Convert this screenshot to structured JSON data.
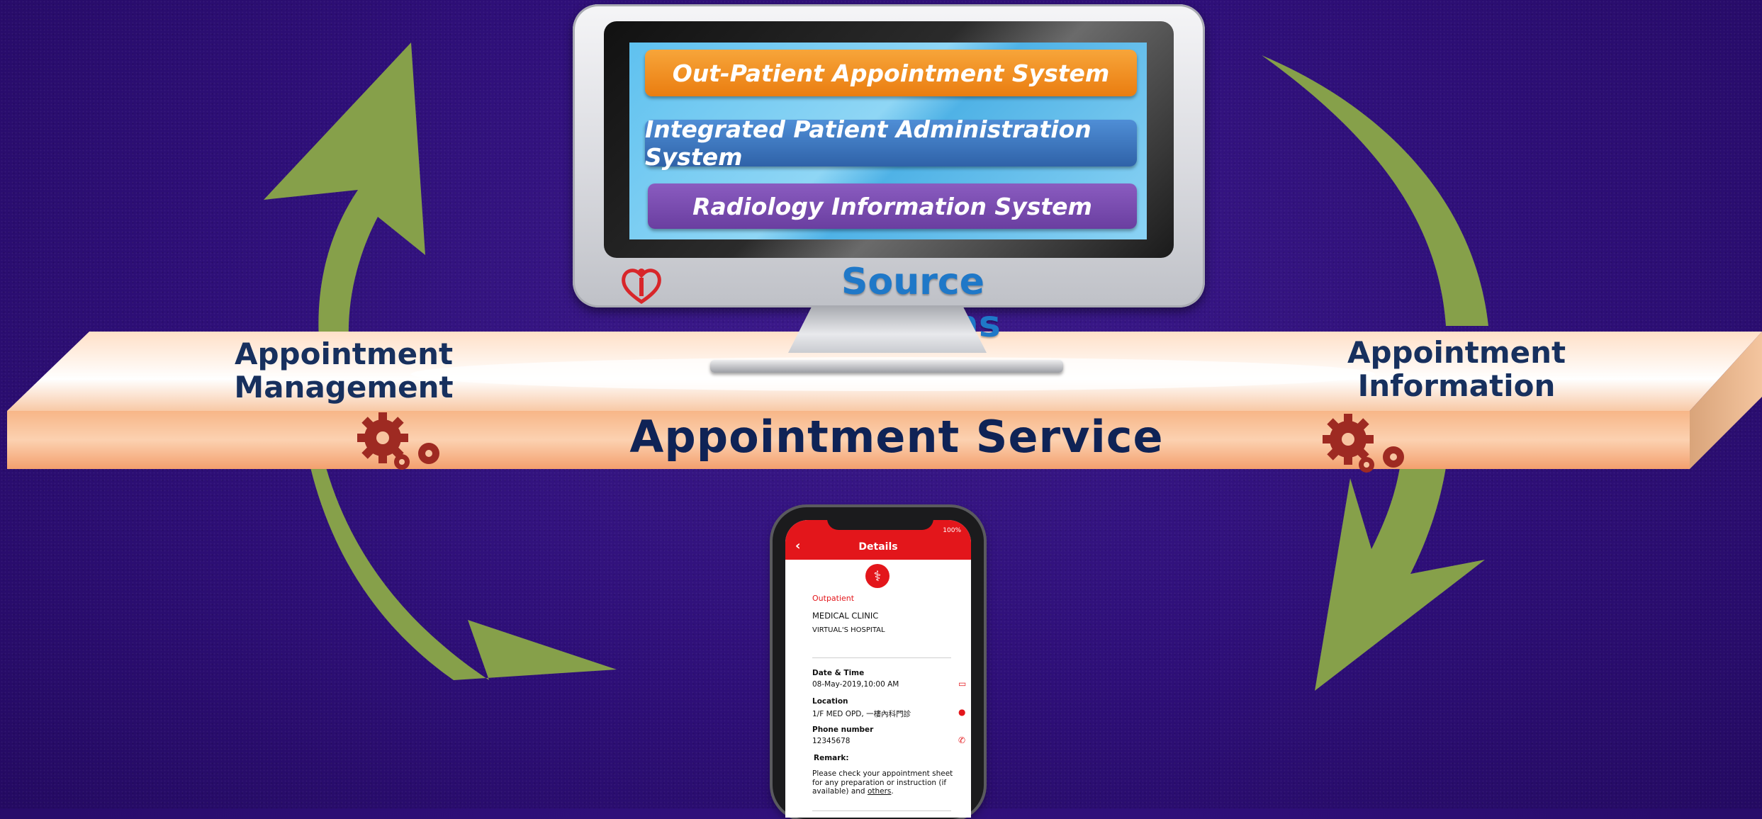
{
  "monitor": {
    "systems": [
      {
        "label": "Out-Patient Appointment System",
        "color": "#ea7d10"
      },
      {
        "label": "Integrated Patient Administration System",
        "color": "#2f62a8"
      },
      {
        "label": "Radiology Information System",
        "color": "#6a3ea0"
      }
    ],
    "title": "Source Systems",
    "logo_icon": "hospital-authority-logo"
  },
  "band": {
    "left_label_line1": "Appointment",
    "left_label_line2": "Management",
    "right_label_line1": "Appointment",
    "right_label_line2": "Information",
    "title": "Appointment Service",
    "gear_icon": "gears-icon"
  },
  "arrows": {
    "color": "#86a04a",
    "icon": "cycle-arrow-icon"
  },
  "phone": {
    "status": "100%",
    "back_icon": "chevron-left-icon",
    "title": "Details",
    "category": "Outpatient",
    "clinic": "MEDICAL CLINIC",
    "hospital": "VIRTUAL'S HOSPITAL",
    "fields": {
      "datetime_label": "Date & Time",
      "datetime_value": "08-May-2019,10:00 AM",
      "location_label": "Location",
      "location_value": "1/F MED OPD, 一樓內科門診",
      "phone_label": "Phone number",
      "phone_value": "12345678",
      "remark_label": "Remark:",
      "remark_value": "Please check your appointment sheet for any preparation or instruction (if available) and",
      "remark_link": "others",
      "remark_end": "."
    }
  }
}
